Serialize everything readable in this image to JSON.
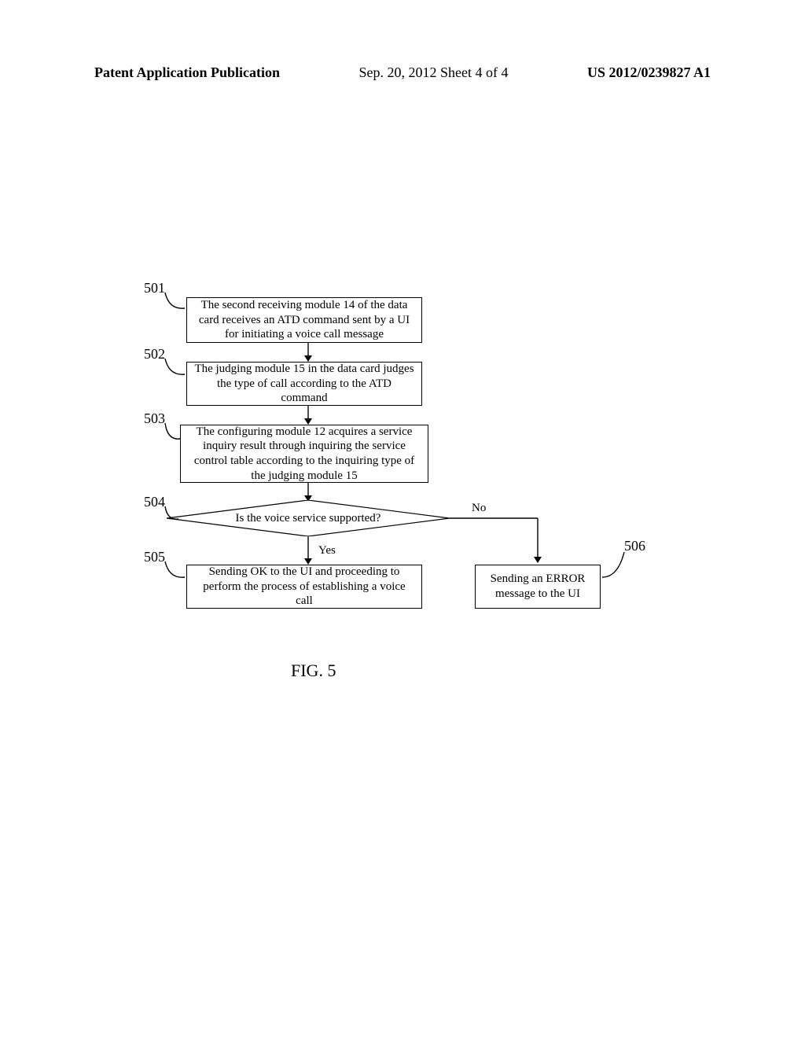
{
  "header": {
    "left": "Patent Application Publication",
    "mid": "Sep. 20, 2012  Sheet 4 of 4",
    "right": "US 2012/0239827 A1"
  },
  "refs": {
    "r501": "501",
    "r502": "502",
    "r503": "503",
    "r504": "504",
    "r505": "505",
    "r506": "506"
  },
  "boxes": {
    "b501": "The second receiving module 14 of the data card receives an ATD command sent by a UI for initiating a voice call message",
    "b502": "The judging module 15 in the data card judges the type of call according to the ATD command",
    "b503": "The configuring module 12 acquires a service inquiry result through inquiring the service control table according to the inquiring type of the judging module 15",
    "b504": "Is the voice service supported?",
    "b505": "Sending OK to the UI and proceeding to perform the process of establishing a voice call",
    "b506": "Sending an ERROR message to the UI"
  },
  "edges": {
    "yes": "Yes",
    "no": "No"
  },
  "figure_caption": "FIG. 5"
}
